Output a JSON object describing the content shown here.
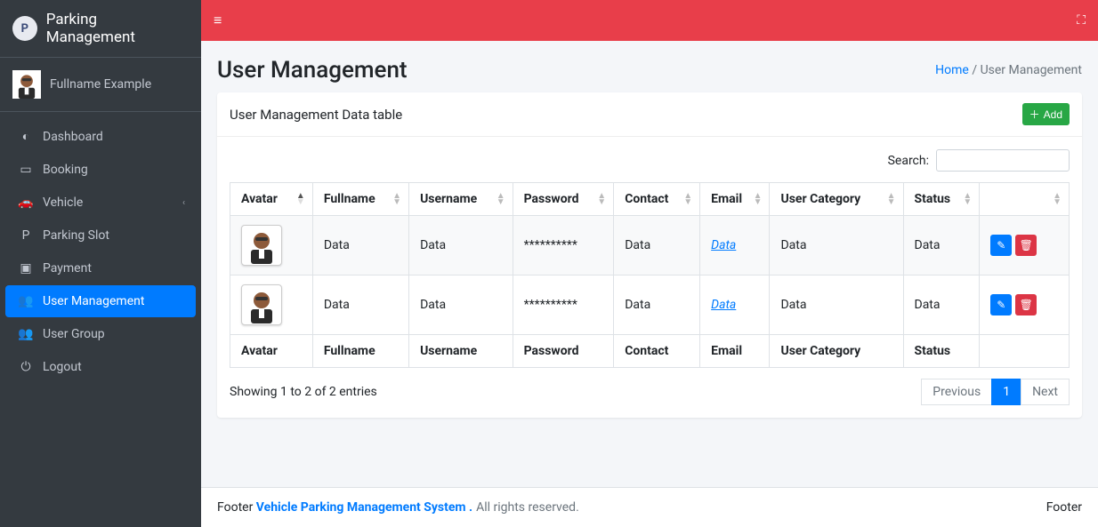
{
  "brand": {
    "logo_text": "P",
    "name": "Parking Management"
  },
  "current_user": {
    "fullname": "Fullname Example"
  },
  "sidebar": {
    "items": [
      {
        "icon": "dashboard-icon",
        "label": "Dashboard",
        "active": false,
        "has_children": false
      },
      {
        "icon": "booking-icon",
        "label": "Booking",
        "active": false,
        "has_children": false
      },
      {
        "icon": "vehicle-icon",
        "label": "Vehicle",
        "active": false,
        "has_children": true
      },
      {
        "icon": "parking-icon",
        "label": "Parking Slot",
        "active": false,
        "has_children": false
      },
      {
        "icon": "payment-icon",
        "label": "Payment",
        "active": false,
        "has_children": false
      },
      {
        "icon": "users-icon",
        "label": "User Management",
        "active": true,
        "has_children": false
      },
      {
        "icon": "group-icon",
        "label": "User Group",
        "active": false,
        "has_children": false
      },
      {
        "icon": "logout-icon",
        "label": "Logout",
        "active": false,
        "has_children": false
      }
    ]
  },
  "breadcrumb": {
    "home": "Home",
    "sep": "/",
    "current": "User Management"
  },
  "page": {
    "title": "User Management"
  },
  "card": {
    "title": "User Management Data table",
    "add_label": "Add",
    "search_label": "Search:",
    "search_value": ""
  },
  "table": {
    "columns": [
      "Avatar",
      "Fullname",
      "Username",
      "Password",
      "Contact",
      "Email",
      "User Category",
      "Status",
      ""
    ],
    "sort_col": 0,
    "sort_dir": "asc",
    "rows": [
      {
        "fullname": "Data",
        "username": "Data",
        "password": "**********",
        "contact": "Data",
        "email": "Data",
        "user_category": "Data",
        "status": "Data"
      },
      {
        "fullname": "Data",
        "username": "Data",
        "password": "**********",
        "contact": "Data",
        "email": "Data",
        "user_category": "Data",
        "status": "Data"
      }
    ],
    "footer_columns": [
      "Avatar",
      "Fullname",
      "Username",
      "Password",
      "Contact",
      "Email",
      "User Category",
      "Status",
      ""
    ]
  },
  "datatable": {
    "info": "Showing 1 to 2 of 2 entries",
    "prev": "Previous",
    "next": "Next",
    "current_page": "1"
  },
  "footer": {
    "left_prefix": "Footer",
    "left_strong": "Vehicle Parking Management System .",
    "left_muted": "All rights reserved.",
    "right": "Footer"
  },
  "icons": {
    "dashboard-icon": "◐",
    "booking-icon": "▭",
    "vehicle-icon": "🚗",
    "parking-icon": "P",
    "payment-icon": "▣",
    "users-icon": "👥",
    "group-icon": "👥",
    "logout-icon": "⏻",
    "chevron-left-icon": "‹",
    "plus-icon": "＋",
    "edit-icon": "✎",
    "trash-icon": "🗑",
    "expand-icon": "⛶",
    "hamburger-icon": "≡"
  }
}
